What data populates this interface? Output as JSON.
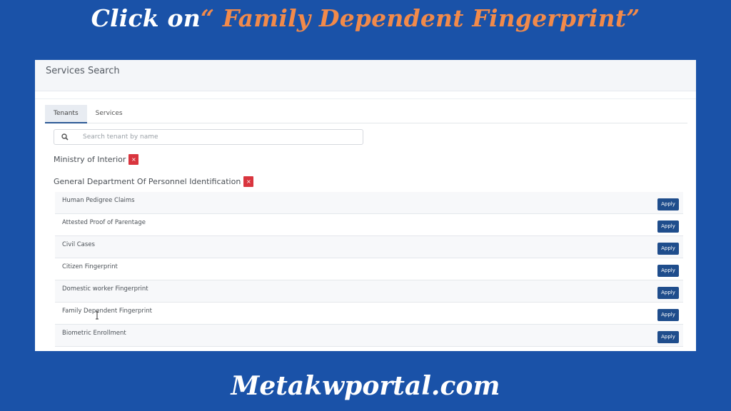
{
  "banner": {
    "prefix": "Click on",
    "highlight": "“ Family Dependent Fingerprint”"
  },
  "footer": {
    "site": "Metakwportal.com"
  },
  "app": {
    "page_title": "Services Search",
    "tabs": [
      {
        "label": "Tenants",
        "active": true
      },
      {
        "label": "Services",
        "active": false
      }
    ],
    "search": {
      "placeholder": "Search tenant by name",
      "value": ""
    },
    "tenants": [
      {
        "name": "Ministry of Interior",
        "remove": "×"
      },
      {
        "name": "General Department Of Personnel Identification",
        "remove": "×"
      }
    ],
    "apply_label": "Apply",
    "services": [
      "Human Pedigree Claims",
      "Attested Proof of Parentage",
      "Civil Cases",
      "Citizen Fingerprint",
      "Domestic worker Fingerprint",
      "Family Dependent Fingerprint",
      "Biometric Enrollment"
    ]
  },
  "colors": {
    "background": "#1a52a8",
    "accent": "#f28a4a",
    "apply_button": "#1f4d8c",
    "remove_badge": "#d9353e"
  },
  "icons": [
    "search-icon",
    "close-icon",
    "text-cursor-icon"
  ]
}
